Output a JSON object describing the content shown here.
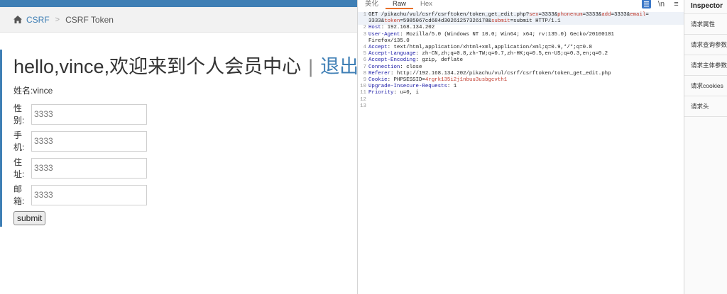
{
  "webpage": {
    "breadcrumb": {
      "section": "CSRF",
      "current": "CSRF Token"
    },
    "header": {
      "greeting": "hello,vince,欢迎来到个人会员中心",
      "divider": "|",
      "logout": "退出"
    },
    "name_line": "姓名:vince",
    "fields": [
      {
        "label": "性别:",
        "placeholder": "3333"
      },
      {
        "label": "手机:",
        "placeholder": "3333"
      },
      {
        "label": "住址:",
        "placeholder": "3333"
      },
      {
        "label": "邮箱:",
        "placeholder": "3333"
      }
    ],
    "submit_label": "submit"
  },
  "editor": {
    "tabs": [
      "美化",
      "Raw",
      "Hex"
    ],
    "active_tab": "Raw",
    "newline_toggle": "\\n",
    "menu_glyph": "≡",
    "lines": [
      {
        "n": "1",
        "parts": [
          {
            "t": "GET /pikachu/vul/csrf/csrftoken/token_get_edit.php?",
            "c": "m"
          },
          {
            "t": "sex",
            "c": "p"
          },
          {
            "t": "=3333&",
            "c": "m"
          },
          {
            "t": "phonenum",
            "c": "p"
          },
          {
            "t": "=3333&",
            "c": "m"
          },
          {
            "t": "add",
            "c": "p"
          },
          {
            "t": "=3333&",
            "c": "m"
          },
          {
            "t": "email",
            "c": "p"
          },
          {
            "t": "=",
            "c": "m"
          }
        ]
      },
      {
        "n": "",
        "parts": [
          {
            "t": "3333&",
            "c": "m"
          },
          {
            "t": "token",
            "c": "p"
          },
          {
            "t": "=5985067cd684d3026125732617",
            "c": "m"
          },
          {
            "t": "8&",
            "c": "m"
          },
          {
            "t": "submit",
            "c": "p"
          },
          {
            "t": "=submit HTTP/1.1",
            "c": "m"
          }
        ]
      },
      {
        "n": "2",
        "parts": [
          {
            "t": "Host",
            "c": "h"
          },
          {
            "t": ": 192.168.134.202",
            "c": "m"
          }
        ]
      },
      {
        "n": "3",
        "parts": [
          {
            "t": "User-Agent",
            "c": "h"
          },
          {
            "t": ": Mozilla/5.0 (Windows NT 10.0; Win64; x64; rv:135.0) Gecko/20100101",
            "c": "m"
          }
        ]
      },
      {
        "n": "",
        "parts": [
          {
            "t": "Firefox/135.0",
            "c": "m"
          }
        ]
      },
      {
        "n": "4",
        "parts": [
          {
            "t": "Accept",
            "c": "h"
          },
          {
            "t": ": text/html,application/xhtml+xml,application/xml;q=0.9,*/*;q=0.8",
            "c": "m"
          }
        ]
      },
      {
        "n": "5",
        "parts": [
          {
            "t": "Accept-Language",
            "c": "h"
          },
          {
            "t": ": zh-CN,zh;q=0.8,zh-TW;q=0.7,zh-HK;q=0.5,en-US;q=0.3,en;q=0.2",
            "c": "m"
          }
        ]
      },
      {
        "n": "6",
        "parts": [
          {
            "t": "Accept-Encoding",
            "c": "h"
          },
          {
            "t": ": gzip, deflate",
            "c": "m"
          }
        ]
      },
      {
        "n": "7",
        "parts": [
          {
            "t": "Connection",
            "c": "h"
          },
          {
            "t": ": close",
            "c": "m"
          }
        ]
      },
      {
        "n": "8",
        "parts": [
          {
            "t": "Referer",
            "c": "h"
          },
          {
            "t": ": http://192.168.134.202/pikachu/vul/csrf/csrftoken/token_get_edit.php",
            "c": "m"
          }
        ]
      },
      {
        "n": "9",
        "parts": [
          {
            "t": "Cookie",
            "c": "h"
          },
          {
            "t": ": PHPSESSID=",
            "c": "m"
          },
          {
            "t": "4rgrk135i2j1nbuu3usbgcvth1",
            "c": "p"
          }
        ]
      },
      {
        "n": "10",
        "parts": [
          {
            "t": "Upgrade-Insecure-Requests",
            "c": "h"
          },
          {
            "t": ": 1",
            "c": "m"
          }
        ]
      },
      {
        "n": "11",
        "parts": [
          {
            "t": "Priority",
            "c": "h"
          },
          {
            "t": ": u=0, i",
            "c": "m"
          }
        ]
      },
      {
        "n": "12",
        "parts": []
      },
      {
        "n": "13",
        "parts": []
      }
    ]
  },
  "inspector": {
    "title": "Inspector",
    "items": [
      "请求属性",
      "请求查询参数",
      "请求主体参数",
      "请求cookies",
      "请求头"
    ]
  },
  "colors": {
    "accent": "#3f7fb5",
    "tab_underline": "#e8702a",
    "header_key": "#1a1aa6",
    "param": "#c0392b"
  }
}
